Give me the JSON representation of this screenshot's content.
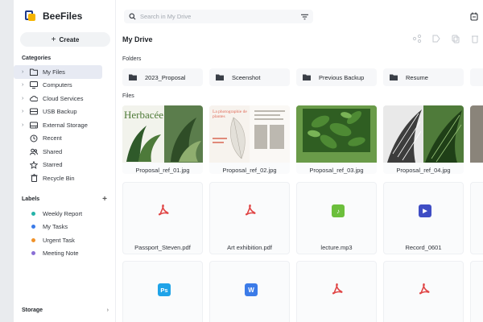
{
  "app": {
    "name": "BeeFiles"
  },
  "sidebar": {
    "create_label": "Create",
    "categories_title": "Categories",
    "categories": [
      {
        "label": "My Files",
        "icon": "folder-icon",
        "active": true,
        "chevron": true
      },
      {
        "label": "Computers",
        "icon": "monitor-icon",
        "chevron": true
      },
      {
        "label": "Cloud Services",
        "icon": "cloud-icon",
        "chevron": true
      },
      {
        "label": "USB Backup",
        "icon": "usb-icon",
        "chevron": true
      },
      {
        "label": "External Storage",
        "icon": "drive-icon",
        "chevron": true
      },
      {
        "label": "Recent",
        "icon": "clock-icon"
      },
      {
        "label": "Shared",
        "icon": "users-icon"
      },
      {
        "label": "Starred",
        "icon": "star-icon"
      },
      {
        "label": "Recycle Bin",
        "icon": "trash-icon"
      }
    ],
    "labels_title": "Labels",
    "labels": [
      {
        "label": "Weekly Report",
        "color": "#25b3a8"
      },
      {
        "label": "My Tasks",
        "color": "#3b7be8"
      },
      {
        "label": "Urgent Task",
        "color": "#f0922a"
      },
      {
        "label": "Meeting Note",
        "color": "#8a6fd6"
      }
    ],
    "storage_title": "Storage"
  },
  "search": {
    "placeholder": "Search in My Drive"
  },
  "main": {
    "title": "My Drive",
    "folders_title": "Folders",
    "folders": [
      "2023_Proposal",
      "Sceenshot",
      "Previous Backup",
      "Resume"
    ],
    "files_title": "Files",
    "image_files": [
      {
        "name": "Proposal_ref_01.jpg",
        "overlay": "Herbacée"
      },
      {
        "name": "Proposal_ref_02.jpg",
        "overlay": "La photographie de plantes"
      },
      {
        "name": "Proposal_ref_03.jpg"
      },
      {
        "name": "Proposal_ref_04.jpg"
      }
    ],
    "doc_files": [
      {
        "name": "Passport_Steven.pdf",
        "type": "pdf"
      },
      {
        "name": "Art exhibition.pdf",
        "type": "pdf"
      },
      {
        "name": "lecture.mp3",
        "type": "mp3"
      },
      {
        "name": "Record_0601",
        "type": "video"
      }
    ],
    "row3_files": [
      {
        "type": "ps",
        "badge": "Ps"
      },
      {
        "type": "word",
        "badge": "W"
      },
      {
        "type": "pdf"
      },
      {
        "type": "pdf"
      }
    ]
  },
  "colors": {
    "pdf": "#e04545",
    "mp3": "#6cbf3c",
    "video": "#3f4dc4",
    "ps": "#1fa3e8",
    "word": "#3b7be8"
  }
}
